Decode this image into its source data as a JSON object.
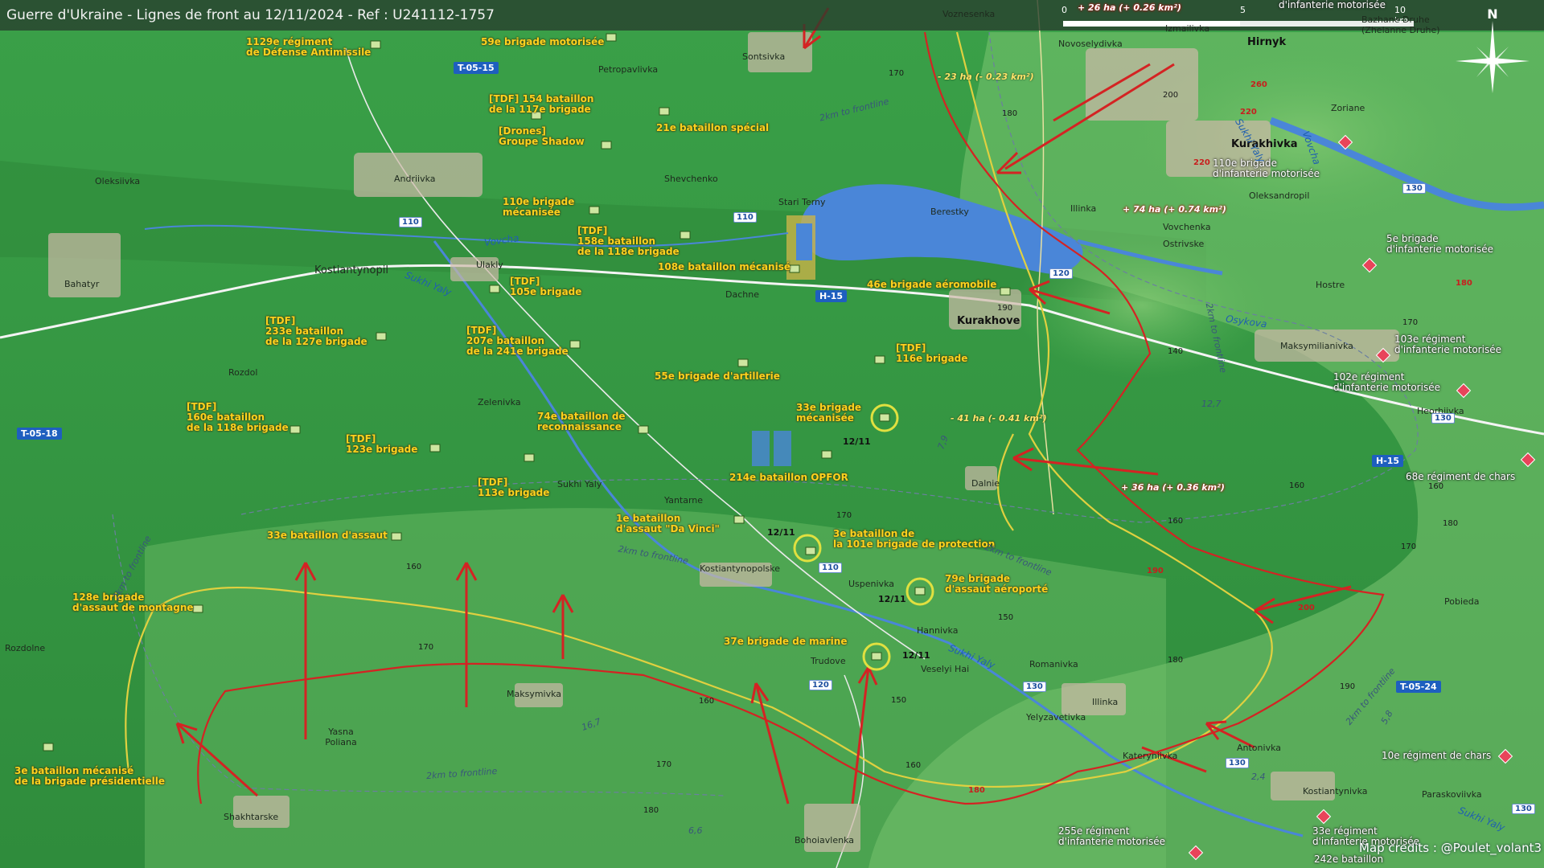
{
  "title": "Guerre d'Ukraine - Lignes de front au 12/11/2024 - Ref : U241112-1757",
  "scale": {
    "ticks": [
      "0",
      "5",
      "10 km"
    ]
  },
  "compass": {
    "label": "N"
  },
  "credits": "Map credits : @Poulet_volant3",
  "colors": {
    "terrain_dark": "#2f8a3a",
    "terrain_light": "#72c46a",
    "water": "#4a86d8",
    "ua_front": "#e0d040",
    "ru_arrow": "#d42323",
    "ua_unit": "#ffd21e",
    "ru_unit": "#e8445a"
  },
  "ua_units": [
    {
      "lines": [
        "1129e régiment",
        "de Défense Antimissile"
      ],
      "icon": "air-defense-unit-icon"
    },
    {
      "lines": [
        "59e brigade motorisée"
      ],
      "icon": "brigade-icon"
    },
    {
      "lines": [
        "[TDF] 154 bataillon",
        "de la 117e brigade"
      ],
      "icon": "battalion-icon"
    },
    {
      "lines": [
        "21e bataillon spécial"
      ],
      "icon": "battalion-icon"
    },
    {
      "lines": [
        "[Drones]",
        "Groupe Shadow"
      ],
      "icon": "drone-group-icon"
    },
    {
      "lines": [
        "110e brigade",
        "mécanisée"
      ],
      "icon": "brigade-icon"
    },
    {
      "lines": [
        "[TDF]",
        "158e bataillon",
        "de la 118e brigade"
      ],
      "icon": "battalion-icon"
    },
    {
      "lines": [
        "108e bataillon mécanisé"
      ],
      "icon": "battalion-icon"
    },
    {
      "lines": [
        "[TDF]",
        "105e brigade"
      ],
      "icon": "brigade-icon"
    },
    {
      "lines": [
        "46e brigade aéromobile"
      ],
      "icon": "brigade-icon"
    },
    {
      "lines": [
        "[TDF]",
        "233e bataillon",
        "de la 127e brigade"
      ],
      "icon": "battalion-icon"
    },
    {
      "lines": [
        "[TDF]",
        "207e bataillon",
        "de la 241e brigade"
      ],
      "icon": "battalion-icon"
    },
    {
      "lines": [
        "[TDF]",
        "116e brigade"
      ],
      "icon": "brigade-icon"
    },
    {
      "lines": [
        "55e brigade d'artillerie"
      ],
      "icon": "artillery-brigade-icon"
    },
    {
      "lines": [
        "[TDF]",
        "160e bataillon",
        "de la 118e brigade"
      ],
      "icon": "battalion-icon"
    },
    {
      "lines": [
        "74e bataillon de",
        "reconnaissance"
      ],
      "icon": "battalion-icon"
    },
    {
      "lines": [
        "33e brigade",
        "mécanisée"
      ],
      "icon": "brigade-icon"
    },
    {
      "lines": [
        "[TDF]",
        "123e brigade"
      ],
      "icon": "brigade-icon"
    },
    {
      "lines": [
        "214e bataillon OPFOR"
      ],
      "icon": "battalion-icon"
    },
    {
      "lines": [
        "[TDF]",
        "113e brigade"
      ],
      "icon": "brigade-icon"
    },
    {
      "lines": [
        "1e bataillon",
        "d'assaut \"Da Vinci\""
      ],
      "icon": "battalion-icon"
    },
    {
      "lines": [
        "3e bataillon de",
        "la 101e brigade de protection"
      ],
      "icon": "battalion-icon"
    },
    {
      "lines": [
        "33e bataillon d'assaut"
      ],
      "icon": "battalion-icon"
    },
    {
      "lines": [
        "79e brigade",
        "d'assaut aéroporté"
      ],
      "icon": "brigade-icon"
    },
    {
      "lines": [
        "128e brigade",
        "d'assaut de montagne"
      ],
      "icon": "brigade-icon"
    },
    {
      "lines": [
        "37e brigade de marine"
      ],
      "icon": "brigade-icon"
    },
    {
      "lines": [
        "3e bataillon mécanisé",
        "de la brigade présidentielle"
      ],
      "icon": "battalion-icon"
    }
  ],
  "ru_units": [
    {
      "lines": [
        "d'infanterie motorisée"
      ]
    },
    {
      "lines": [
        "110e brigade",
        "d'infanterie motorisée"
      ]
    },
    {
      "lines": [
        "5e brigade",
        "d'infanterie motorisée"
      ]
    },
    {
      "lines": [
        "103e régiment",
        "d'infanterie motorisée"
      ]
    },
    {
      "lines": [
        "102e régiment",
        "d'infanterie motorisée"
      ]
    },
    {
      "lines": [
        "68e régiment de chars"
      ]
    },
    {
      "lines": [
        "10e régiment de chars"
      ]
    },
    {
      "lines": [
        "255e régiment",
        "d'infanterie motorisée"
      ]
    },
    {
      "lines": [
        "33e régiment",
        "d'infanterie motorisée"
      ]
    },
    {
      "lines": [
        "242e bataillon"
      ]
    }
  ],
  "towns": [
    {
      "name": "Kurakhove",
      "bold": true
    },
    {
      "name": "Hirnyk",
      "bold": true
    },
    {
      "name": "Kurakhivka",
      "bold": true
    },
    {
      "name": "Voznesenka"
    },
    {
      "name": "Novoselydivka"
    },
    {
      "name": "Izmailivka"
    },
    {
      "name": "Bazhane Druhe (Zhelanne Druhe)"
    },
    {
      "name": "Sontsivka"
    },
    {
      "name": "Petropavlivka"
    },
    {
      "name": "Zoriane"
    },
    {
      "name": "Oleksiivka"
    },
    {
      "name": "Andriivka"
    },
    {
      "name": "Shevchenko"
    },
    {
      "name": "Stari Terny"
    },
    {
      "name": "Berestky"
    },
    {
      "name": "Illinka"
    },
    {
      "name": "Oleksandropil"
    },
    {
      "name": "Vovchenka"
    },
    {
      "name": "Ostrivske"
    },
    {
      "name": "Bahatyr"
    },
    {
      "name": "Kostiantynopil"
    },
    {
      "name": "Ulakly"
    },
    {
      "name": "Dachne"
    },
    {
      "name": "Hostre"
    },
    {
      "name": "Maksymilianivka"
    },
    {
      "name": "Rozdol"
    },
    {
      "name": "Zelenivka"
    },
    {
      "name": "Heorhiivka"
    },
    {
      "name": "Dalnie"
    },
    {
      "name": "Sukhi Yaly"
    },
    {
      "name": "Yantarne"
    },
    {
      "name": "Kostiantynopolske"
    },
    {
      "name": "Uspenivka"
    },
    {
      "name": "Pobieda"
    },
    {
      "name": "Hannivka"
    },
    {
      "name": "Rozdolne"
    },
    {
      "name": "Romanivka"
    },
    {
      "name": "Trudove"
    },
    {
      "name": "Veselyi Hai"
    },
    {
      "name": "Maksymivka"
    },
    {
      "name": "Illinka"
    },
    {
      "name": "Yelyzavetivka"
    },
    {
      "name": "Yasna Poliana"
    },
    {
      "name": "Kateryniivka"
    },
    {
      "name": "Antonivka"
    },
    {
      "name": "Kostiantynivka"
    },
    {
      "name": "Paraskoviivka"
    },
    {
      "name": "Shakhtarske"
    },
    {
      "name": "Bohoiavlenka"
    }
  ],
  "rivers": [
    "Vovcha",
    "Sukhi Yaly",
    "Vovcha",
    "Osykova",
    "Sukhi Yaly",
    "Sukhi Yaly",
    "Sukhi Yaly"
  ],
  "road_shields": {
    "blue": [
      "T-05-15",
      "T-05-18",
      "H-15",
      "H-15",
      "T-05-24"
    ],
    "white": [
      "110",
      "110",
      "120",
      "130",
      "130",
      "130",
      "110",
      "120",
      "130",
      "130"
    ]
  },
  "front_labels": [
    "2km to frontline",
    "2km to frontline",
    "2km to frontline",
    "2km to frontline",
    "2km to frontline",
    "2km to frontline",
    "2km to frontline"
  ],
  "area_changes": [
    {
      "text": "+ 26 ha (+ 0.26 km²)",
      "side": "ru"
    },
    {
      "text": "- 23 ha (- 0.23 km²)",
      "side": "ua"
    },
    {
      "text": "+ 74 ha (+ 0.74 km²)",
      "side": "ru"
    },
    {
      "text": "- 41 ha (- 0.41 km²)",
      "side": "ua"
    },
    {
      "text": "+ 36 ha (+ 0.36 km²)",
      "side": "ru"
    }
  ],
  "altitudes": [
    "170",
    "180",
    "200",
    "260",
    "220",
    "220",
    "140",
    "170",
    "160",
    "160",
    "170",
    "180",
    "160",
    "170",
    "150",
    "160",
    "170",
    "180",
    "190",
    "160",
    "150",
    "170",
    "180",
    "160",
    "190"
  ],
  "altitudes_red": [
    "260",
    "220",
    "220",
    "180",
    "190",
    "200",
    "180"
  ],
  "distances": [
    "12,7",
    "7,9",
    "16,7",
    "6,6",
    "2,4",
    "5,8"
  ],
  "dates": [
    "12/11",
    "12/11",
    "12/11",
    "12/11"
  ]
}
